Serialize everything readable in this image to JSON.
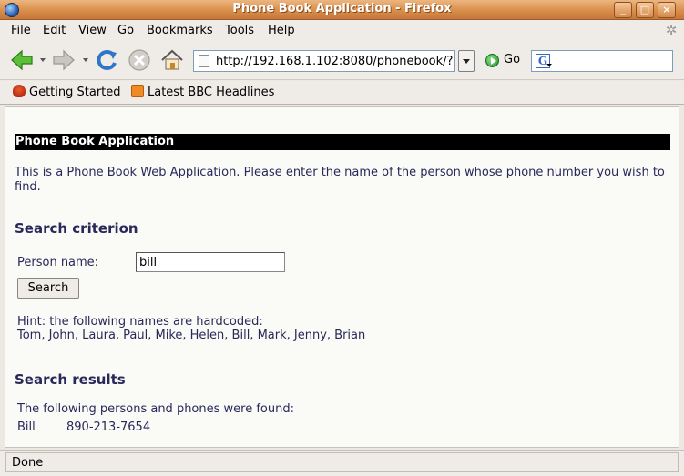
{
  "window": {
    "title": "Phone Book Application - Firefox"
  },
  "menu": [
    "File",
    "Edit",
    "View",
    "Go",
    "Bookmarks",
    "Tools",
    "Help"
  ],
  "toolbar": {
    "url": "http://192.168.1.102:8080/phonebook/?r",
    "go_label": "Go"
  },
  "bookmarks": [
    {
      "label": "Getting Started"
    },
    {
      "label": "Latest BBC Headlines"
    }
  ],
  "page": {
    "heading": "Phone Book Application",
    "intro": "This is a Phone Book Web Application. Please enter the name of the person whose phone number you wish to find.",
    "criterion_heading": "Search criterion",
    "name_label": "Person name:",
    "name_value": "bill",
    "search_button": "Search",
    "hint_line1": "Hint: the following names are hardcoded:",
    "hint_line2": "Tom, John, Laura, Paul, Mike, Helen, Bill, Mark, Jenny, Brian",
    "results_heading": "Search results",
    "found_text": "The following persons and phones were found:",
    "results": [
      {
        "name": "Bill",
        "phone": "890-213-7654"
      }
    ]
  },
  "status": {
    "text": "Done"
  }
}
